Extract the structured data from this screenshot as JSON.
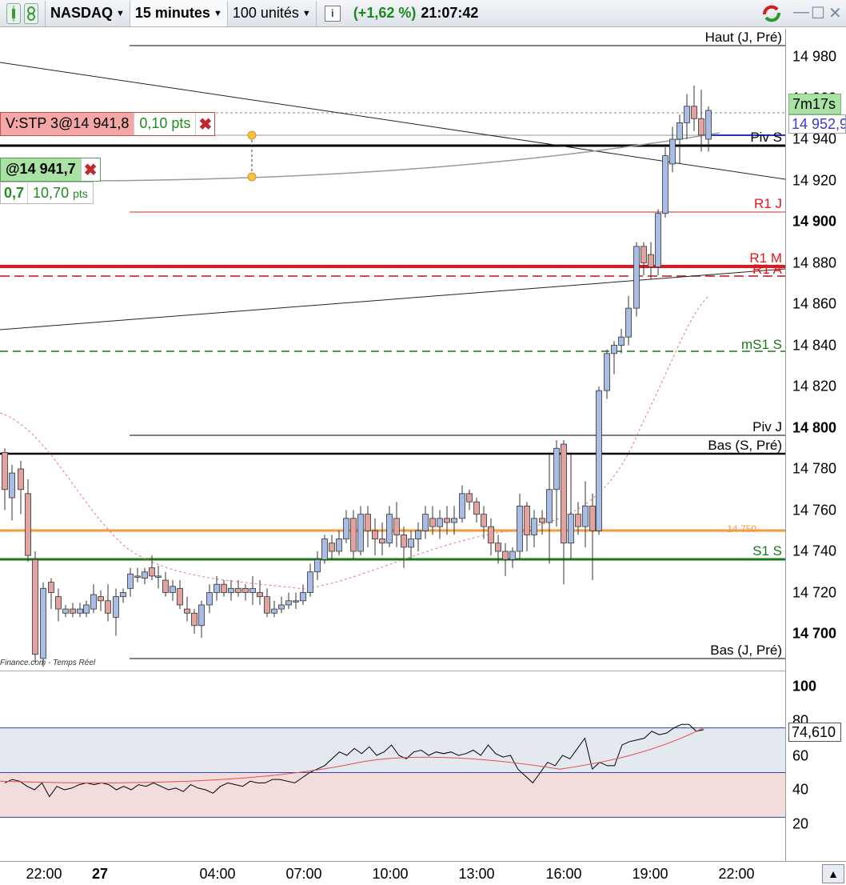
{
  "toolbar": {
    "instrument": "NASDAQ",
    "timeframe": "15 minutes",
    "units": "100 unités",
    "change": "(+1,62 %)",
    "time": "21:07:42",
    "info_icon": "i"
  },
  "price_axis": {
    "labels": [
      "14 980",
      "14 960",
      "14 940",
      "14 920",
      "14 900",
      "14 880",
      "14 860",
      "14 840",
      "14 820",
      "14 800",
      "14 780",
      "14 760",
      "14 740",
      "14 720",
      "14 700"
    ],
    "major": [
      "14 900",
      "14 800",
      "14 700"
    ],
    "timer": "7m17s",
    "current_price": "14 952,9"
  },
  "rsi_axis": {
    "labels": [
      "100",
      "80",
      "60",
      "40",
      "20"
    ],
    "current": "74,610"
  },
  "time_axis": {
    "labels": [
      "22:00",
      "27",
      "04:00",
      "07:00",
      "10:00",
      "13:00",
      "16:00",
      "19:00",
      "22:00"
    ]
  },
  "levels": {
    "haut_j": "Haut (J, Pré)",
    "piv_s": "Piv S",
    "r1_j": "R1 J",
    "r1_m": "R1 M",
    "r1_a": "R1 A",
    "ms1_s": "mS1 S",
    "piv_j": "Piv J",
    "bas_s": "Bas (S, Pré)",
    "orange_level": "14 750",
    "s1_s": "S1 S",
    "bas_j": "Bas (J, Pré)"
  },
  "orders": {
    "stop_label": "V:STP 3@14 941,8",
    "stop_pts": "0,10 pts",
    "position_label": "@14 941,7",
    "position_a": "0,7",
    "position_b": "10,70",
    "position_b_unit": "pts"
  },
  "source": "Finance.com - Temps Réel",
  "colors": {
    "up_candle": "#a8bde6",
    "down_candle": "#e2a3a0",
    "r1_line": "#e8141c",
    "support_green": "#1a7a1a",
    "orange": "#f39a3c",
    "rsi_band_top": "#e4e9f0",
    "rsi_band_bottom": "#f3dcdc"
  }
}
